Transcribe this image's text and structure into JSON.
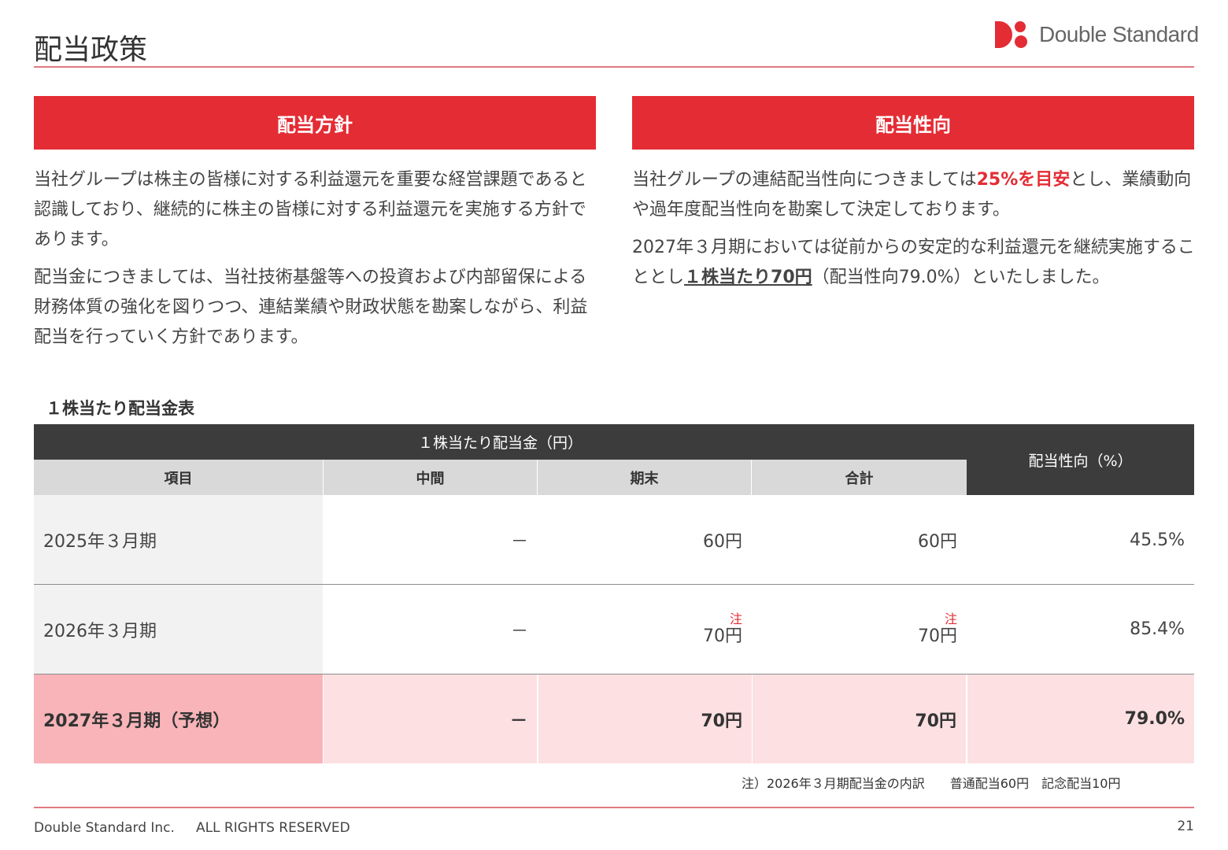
{
  "header": {
    "title": "配当政策",
    "logo_text": "Double Standard",
    "logo_color": "#e42c34"
  },
  "policy": {
    "heading": "配当方針",
    "paragraphs": [
      "当社グループは株主の皆様に対する利益還元を重要な経営課題であると認識しており、継続的に株主の皆様に対する利益還元を実施する方針であります。",
      "配当金につきましては、当社技術基盤等への投資および内部留保による財務体質の強化を図りつつ、連結業績や財政状態を勘案しながら、利益配当を行っていく方針であります。"
    ]
  },
  "payout": {
    "heading": "配当性向",
    "p1_before": "当社グループの連結配当性向につきましては",
    "p1_highlight": "25%を目安",
    "p1_after": "とし、業績動向や過年度配当性向を勘案して決定しております。",
    "p2_before": "2027年３月期においては従前からの安定的な利益還元を継続実施することとし",
    "p2_highlight": "１株当たり70円",
    "p2_after": "（配当性向79.0%）といたしました。"
  },
  "table": {
    "caption": "１株当たり配当金表",
    "group_header": "１株当たり配当金（円）",
    "payout_header": "配当性向（%）",
    "columns": [
      "項目",
      "中間",
      "期末",
      "合計"
    ],
    "note_mark": "注",
    "rows": [
      {
        "label": "2025年３月期",
        "interim": "－",
        "year_end": "60円",
        "total": "60円",
        "payout": "45.5%"
      },
      {
        "label": "2026年３月期",
        "interim": "－",
        "year_end": "70円",
        "total": "70円",
        "payout": "85.4%"
      },
      {
        "label": "2027年３月期（予想）",
        "interim": "－",
        "year_end": "70円",
        "total": "70円",
        "payout": "79.0%"
      }
    ]
  },
  "footnote": "注）2026年３月期配当金の内訳　　普通配当60円　記念配当10円",
  "footer": {
    "copyright": "Double Standard Inc.     ALL RIGHTS RESERVED",
    "page_number": "21"
  },
  "colors": {
    "accent": "#e42c34",
    "header_dark": "#3c3c3c",
    "header_grey": "#d9d9d9",
    "forecast_label": "#f8b4b8",
    "forecast_row": "#fde0e2"
  }
}
